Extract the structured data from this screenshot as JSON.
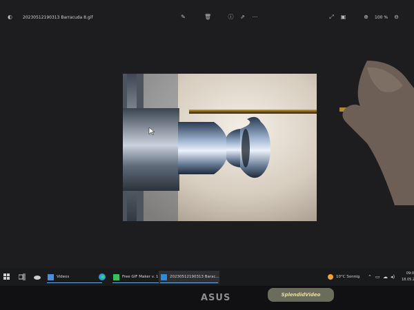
{
  "window": {
    "title": "20230512190313 Barracuda 8.gif",
    "zoom": "100 %",
    "icons": [
      "app-icon",
      "edit-icon",
      "delete-icon",
      "info-icon",
      "share-icon",
      "more-icon",
      "expand-icon",
      "slideshow-icon",
      "zoom-in-icon",
      "zoom-out-icon"
    ]
  },
  "taskbar": {
    "tasks": [
      {
        "label": "Videos",
        "icon": "folder-icon",
        "color": "#4a8fdc"
      },
      {
        "label": "Free GIF Maker v. 1...",
        "icon": "gif-maker-icon",
        "color": "#3bbf5a"
      },
      {
        "label": "20230512190313 Barac...",
        "icon": "photos-icon",
        "color": "#2f8ad8"
      }
    ],
    "weather": "10°C  Sonnig",
    "clock": {
      "time": "09:0",
      "date": "18.05.2"
    }
  },
  "monitor": {
    "brand": "ASUS",
    "badge": "SplendidVideo"
  },
  "colors": {
    "accent": "#6aa8e8",
    "taskbar": "#191a1c",
    "window": "#1d1d1f"
  }
}
